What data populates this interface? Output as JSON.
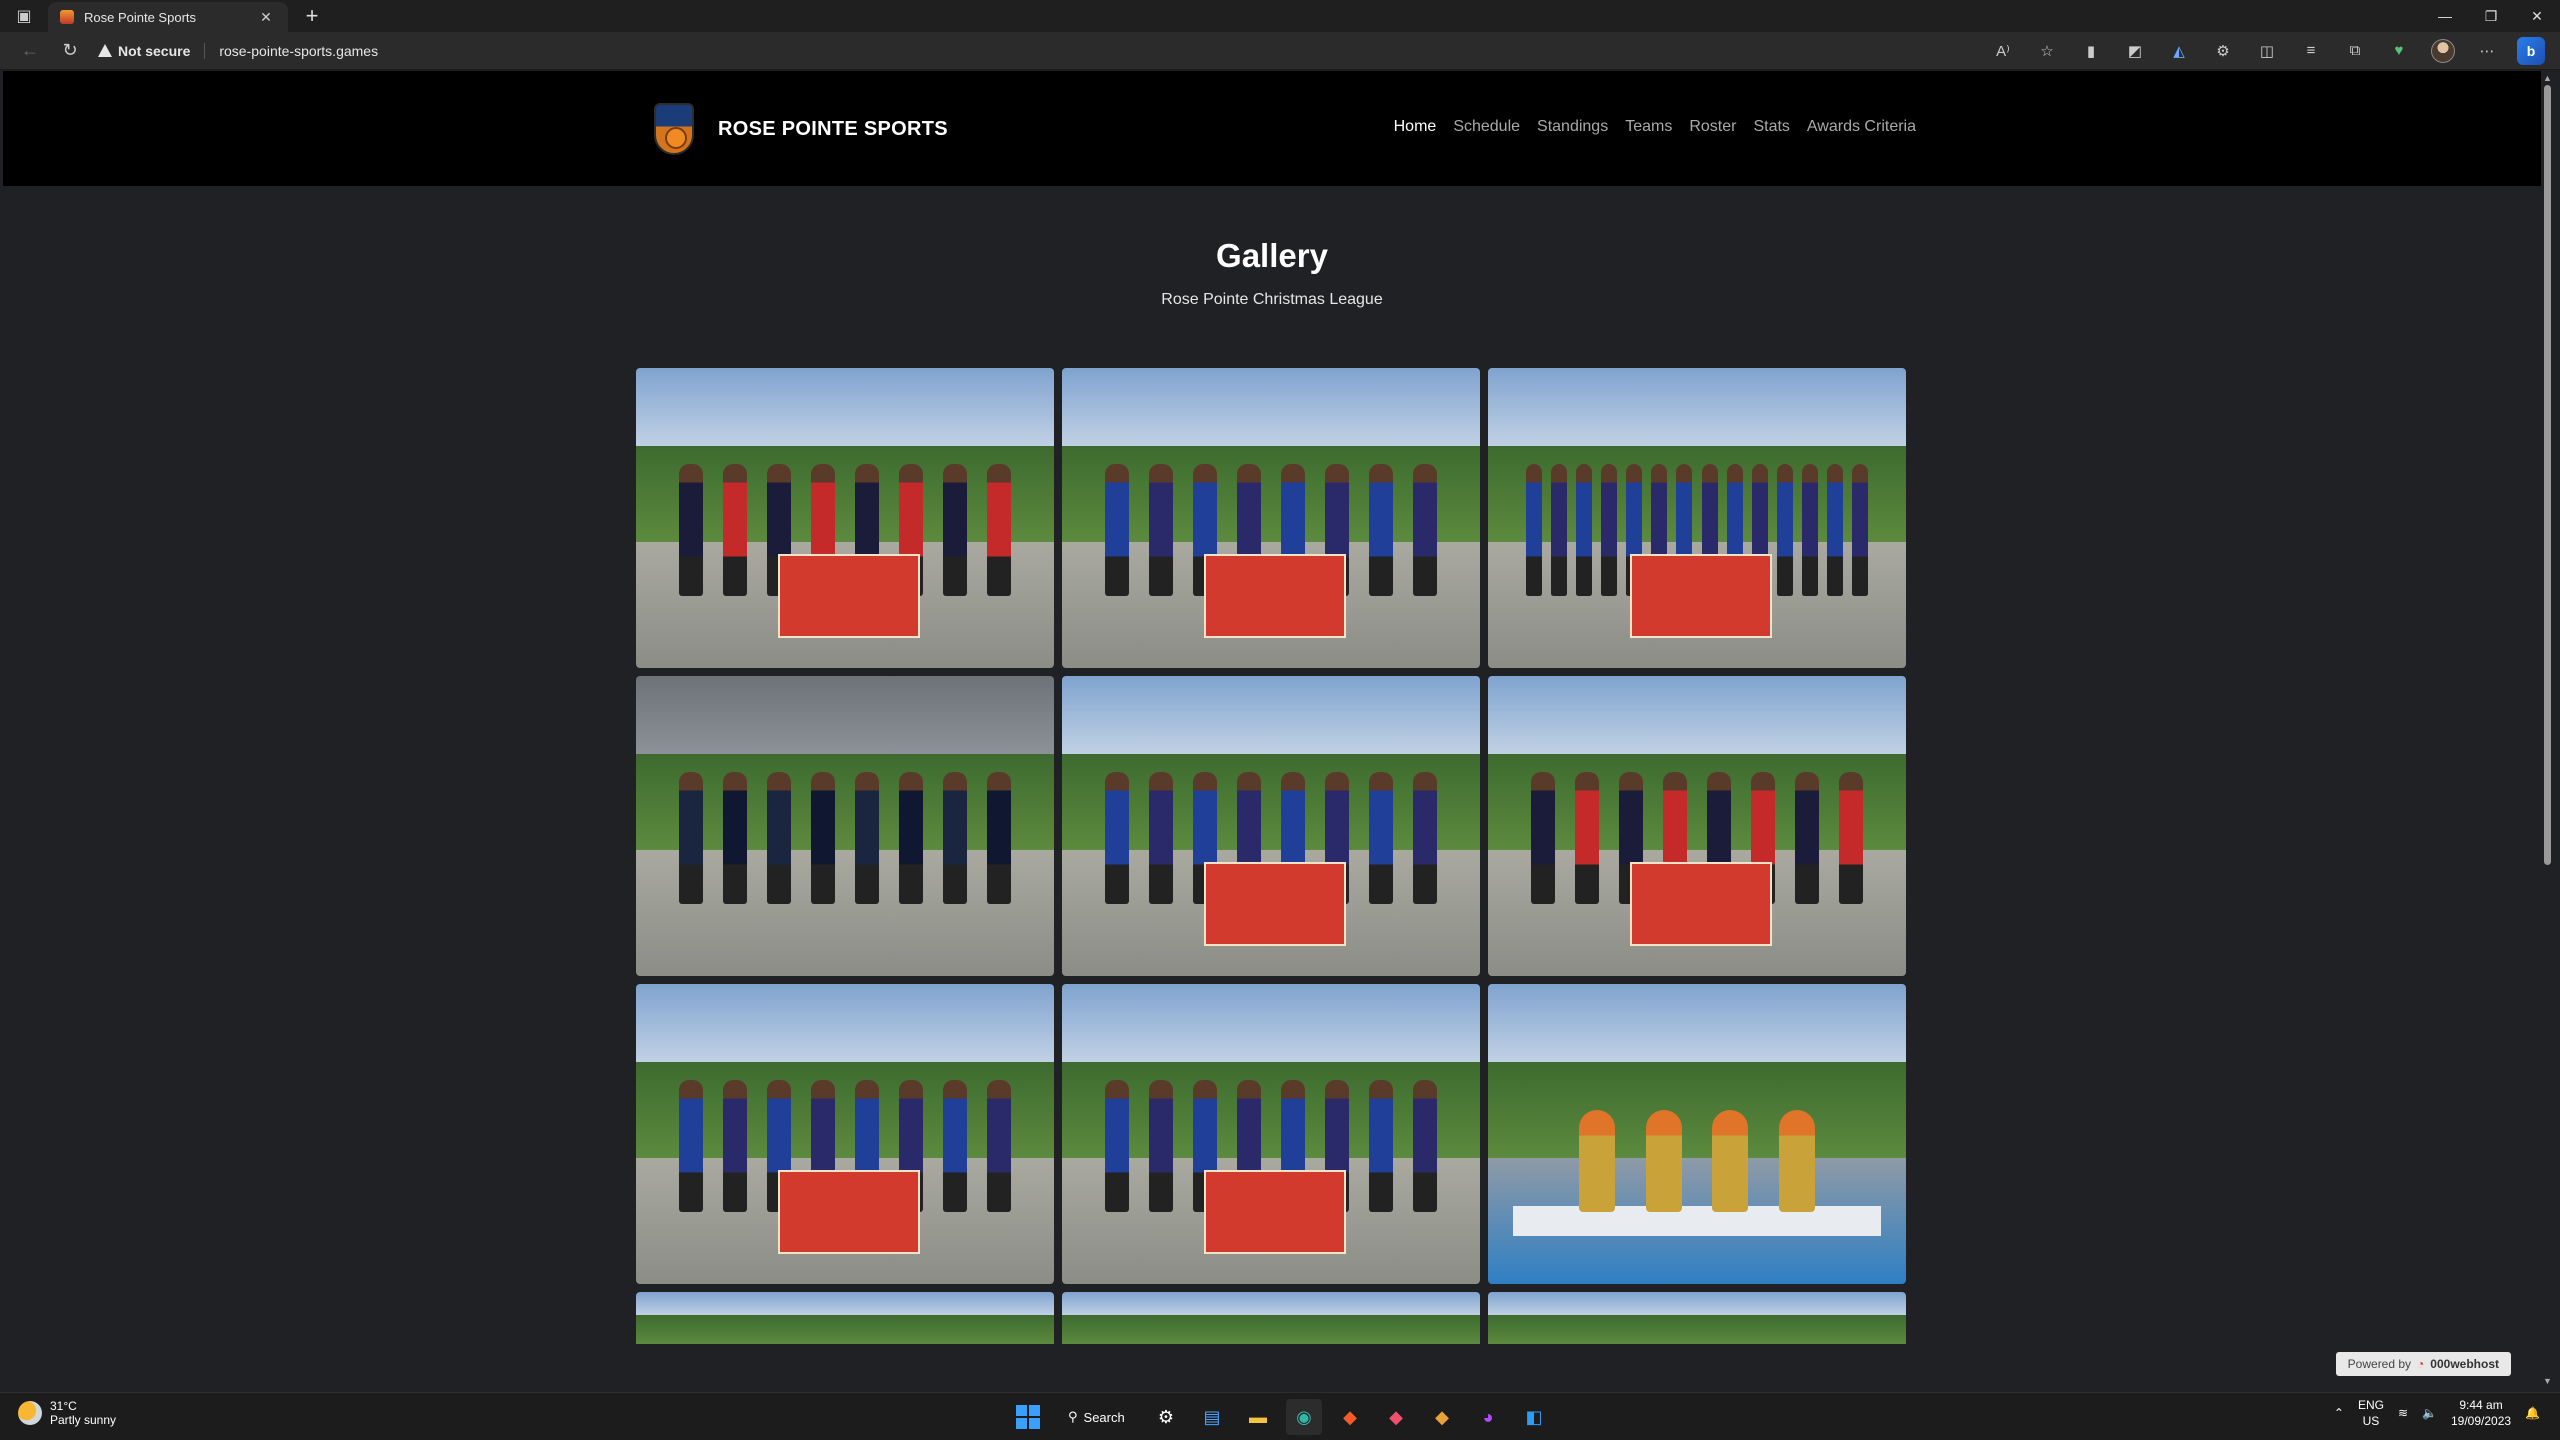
{
  "browser": {
    "tab_title": "Rose Pointe Sports",
    "security_label": "Not secure",
    "url": "rose-pointe-sports.games"
  },
  "site": {
    "brand": "ROSE POINTE SPORTS",
    "nav": [
      "Home",
      "Schedule",
      "Standings",
      "Teams",
      "Roster",
      "Stats",
      "Awards Criteria"
    ],
    "active_nav": "Home"
  },
  "page": {
    "title": "Gallery",
    "subtitle": "Rose Pointe Christmas League"
  },
  "gallery": {
    "photos": [
      {
        "theme": "red",
        "kind": "team"
      },
      {
        "theme": "blue",
        "kind": "team"
      },
      {
        "theme": "blue",
        "kind": "group"
      },
      {
        "theme": "dark",
        "kind": "team"
      },
      {
        "theme": "blue",
        "kind": "team"
      },
      {
        "theme": "red",
        "kind": "team"
      },
      {
        "theme": "blue",
        "kind": "team"
      },
      {
        "theme": "blue",
        "kind": "team"
      },
      {
        "theme": "trophy",
        "kind": "trophies"
      },
      {
        "theme": "sky",
        "kind": "partial"
      },
      {
        "theme": "green",
        "kind": "partial"
      },
      {
        "theme": "sky",
        "kind": "partial"
      }
    ]
  },
  "footer": {
    "powered_label": "Powered by",
    "host": "000webhost"
  },
  "taskbar": {
    "temperature": "31°C",
    "weather": "Partly sunny",
    "search": "Search",
    "lang_top": "ENG",
    "lang_bottom": "US",
    "time": "9:44 am",
    "date": "19/09/2023"
  }
}
